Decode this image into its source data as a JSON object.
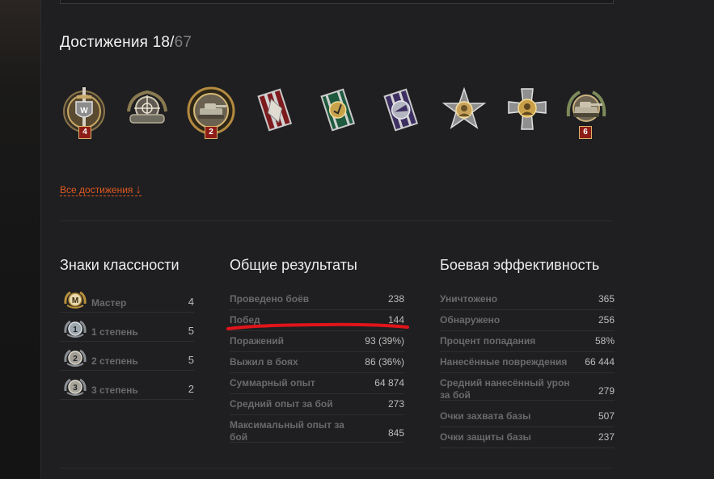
{
  "achievements": {
    "title": "Достижения 18/",
    "total": "67",
    "all_link": "Все достижения",
    "medals": [
      {
        "icon": "sword-shield-medal-icon",
        "badge": "4"
      },
      {
        "icon": "crosshair-tank-medal-icon",
        "badge": ""
      },
      {
        "icon": "tank-laurel-medal-icon",
        "badge": "2"
      },
      {
        "icon": "red-ribbon-medal-icon",
        "badge": ""
      },
      {
        "icon": "green-ribbon-medal-icon",
        "badge": ""
      },
      {
        "icon": "purple-ribbon-medal-icon",
        "badge": ""
      },
      {
        "icon": "star-portrait-medal-icon",
        "badge": ""
      },
      {
        "icon": "cross-portrait-medal-icon",
        "badge": ""
      },
      {
        "icon": "tank-wreath-medal-icon",
        "badge": "6"
      }
    ]
  },
  "classes": {
    "title": "Знаки классности",
    "rows": [
      {
        "icon": "M",
        "label": "Мастер",
        "value": "4"
      },
      {
        "icon": "1",
        "label": "1 степень",
        "value": "5"
      },
      {
        "icon": "2",
        "label": "2 степень",
        "value": "5"
      },
      {
        "icon": "3",
        "label": "3 степень",
        "value": "2"
      }
    ]
  },
  "general": {
    "title": "Общие результаты",
    "rows": [
      {
        "label": "Проведено боёв",
        "value": "238"
      },
      {
        "label": "Побед",
        "value": "144"
      },
      {
        "label": "Поражений",
        "value": "93 (39%)"
      },
      {
        "label": "Выжил в боях",
        "value": "86 (36%)"
      },
      {
        "label": "Суммарный опыт",
        "value": "64 874"
      },
      {
        "label": "Средний опыт за бой",
        "value": "273"
      },
      {
        "label": "Максимальный опыт за бой",
        "value": "845"
      }
    ]
  },
  "combat": {
    "title": "Боевая эффективность",
    "rows": [
      {
        "label": "Уничтожено",
        "value": "365"
      },
      {
        "label": "Обнаружено",
        "value": "256"
      },
      {
        "label": "Процент попадания",
        "value": "58%"
      },
      {
        "label": "Нанесённые повреждения",
        "value": "66 444"
      },
      {
        "label": "Средний нанесённый урон за бой",
        "value": "279"
      },
      {
        "label": "Очки захвата базы",
        "value": "507"
      },
      {
        "label": "Очки защиты базы",
        "value": "237"
      }
    ]
  },
  "colors": {
    "accent": "#e0571f",
    "highlight_line": "#e1141b",
    "badge": "#8e1c16"
  }
}
